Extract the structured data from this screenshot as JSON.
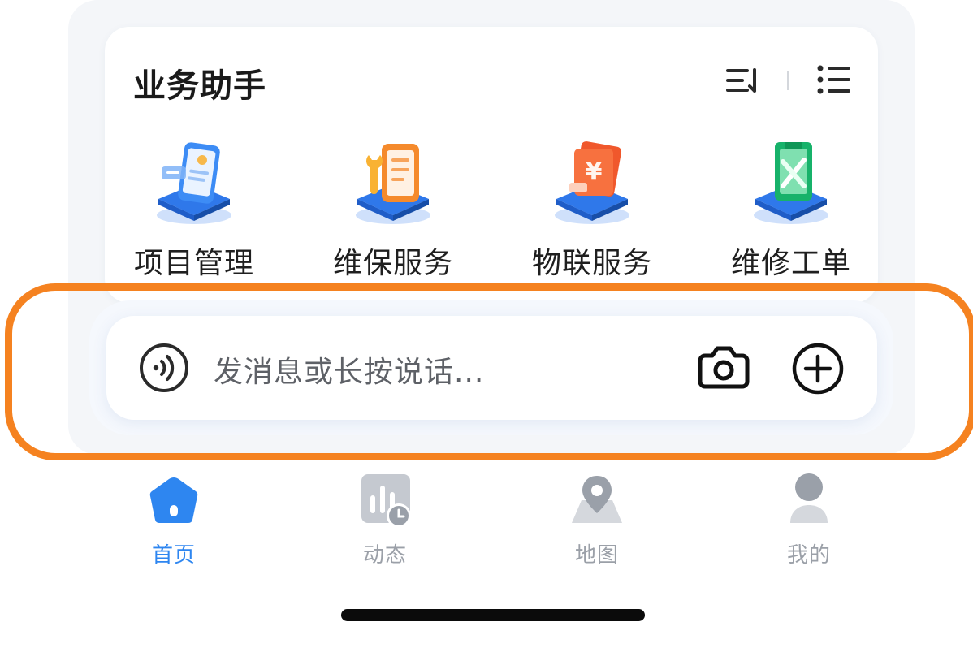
{
  "assistant": {
    "title": "业务助手",
    "shortcuts": [
      {
        "label": "项目管理",
        "icon": "project-management-icon"
      },
      {
        "label": "维保服务",
        "icon": "maintenance-service-icon"
      },
      {
        "label": "物联服务",
        "icon": "iot-service-icon"
      },
      {
        "label": "维修工单",
        "icon": "repair-order-icon"
      }
    ]
  },
  "input_bar": {
    "placeholder": "发消息或长按说话..."
  },
  "tabbar": {
    "tabs": [
      {
        "label": "首页",
        "icon": "home-icon",
        "active": true
      },
      {
        "label": "动态",
        "icon": "activity-icon",
        "active": false
      },
      {
        "label": "地图",
        "icon": "map-icon",
        "active": false
      },
      {
        "label": "我的",
        "icon": "profile-icon",
        "active": false
      }
    ]
  },
  "colors": {
    "accent": "#2e86f0",
    "highlight": "#f58220",
    "inactive": "#9ba0a8"
  }
}
